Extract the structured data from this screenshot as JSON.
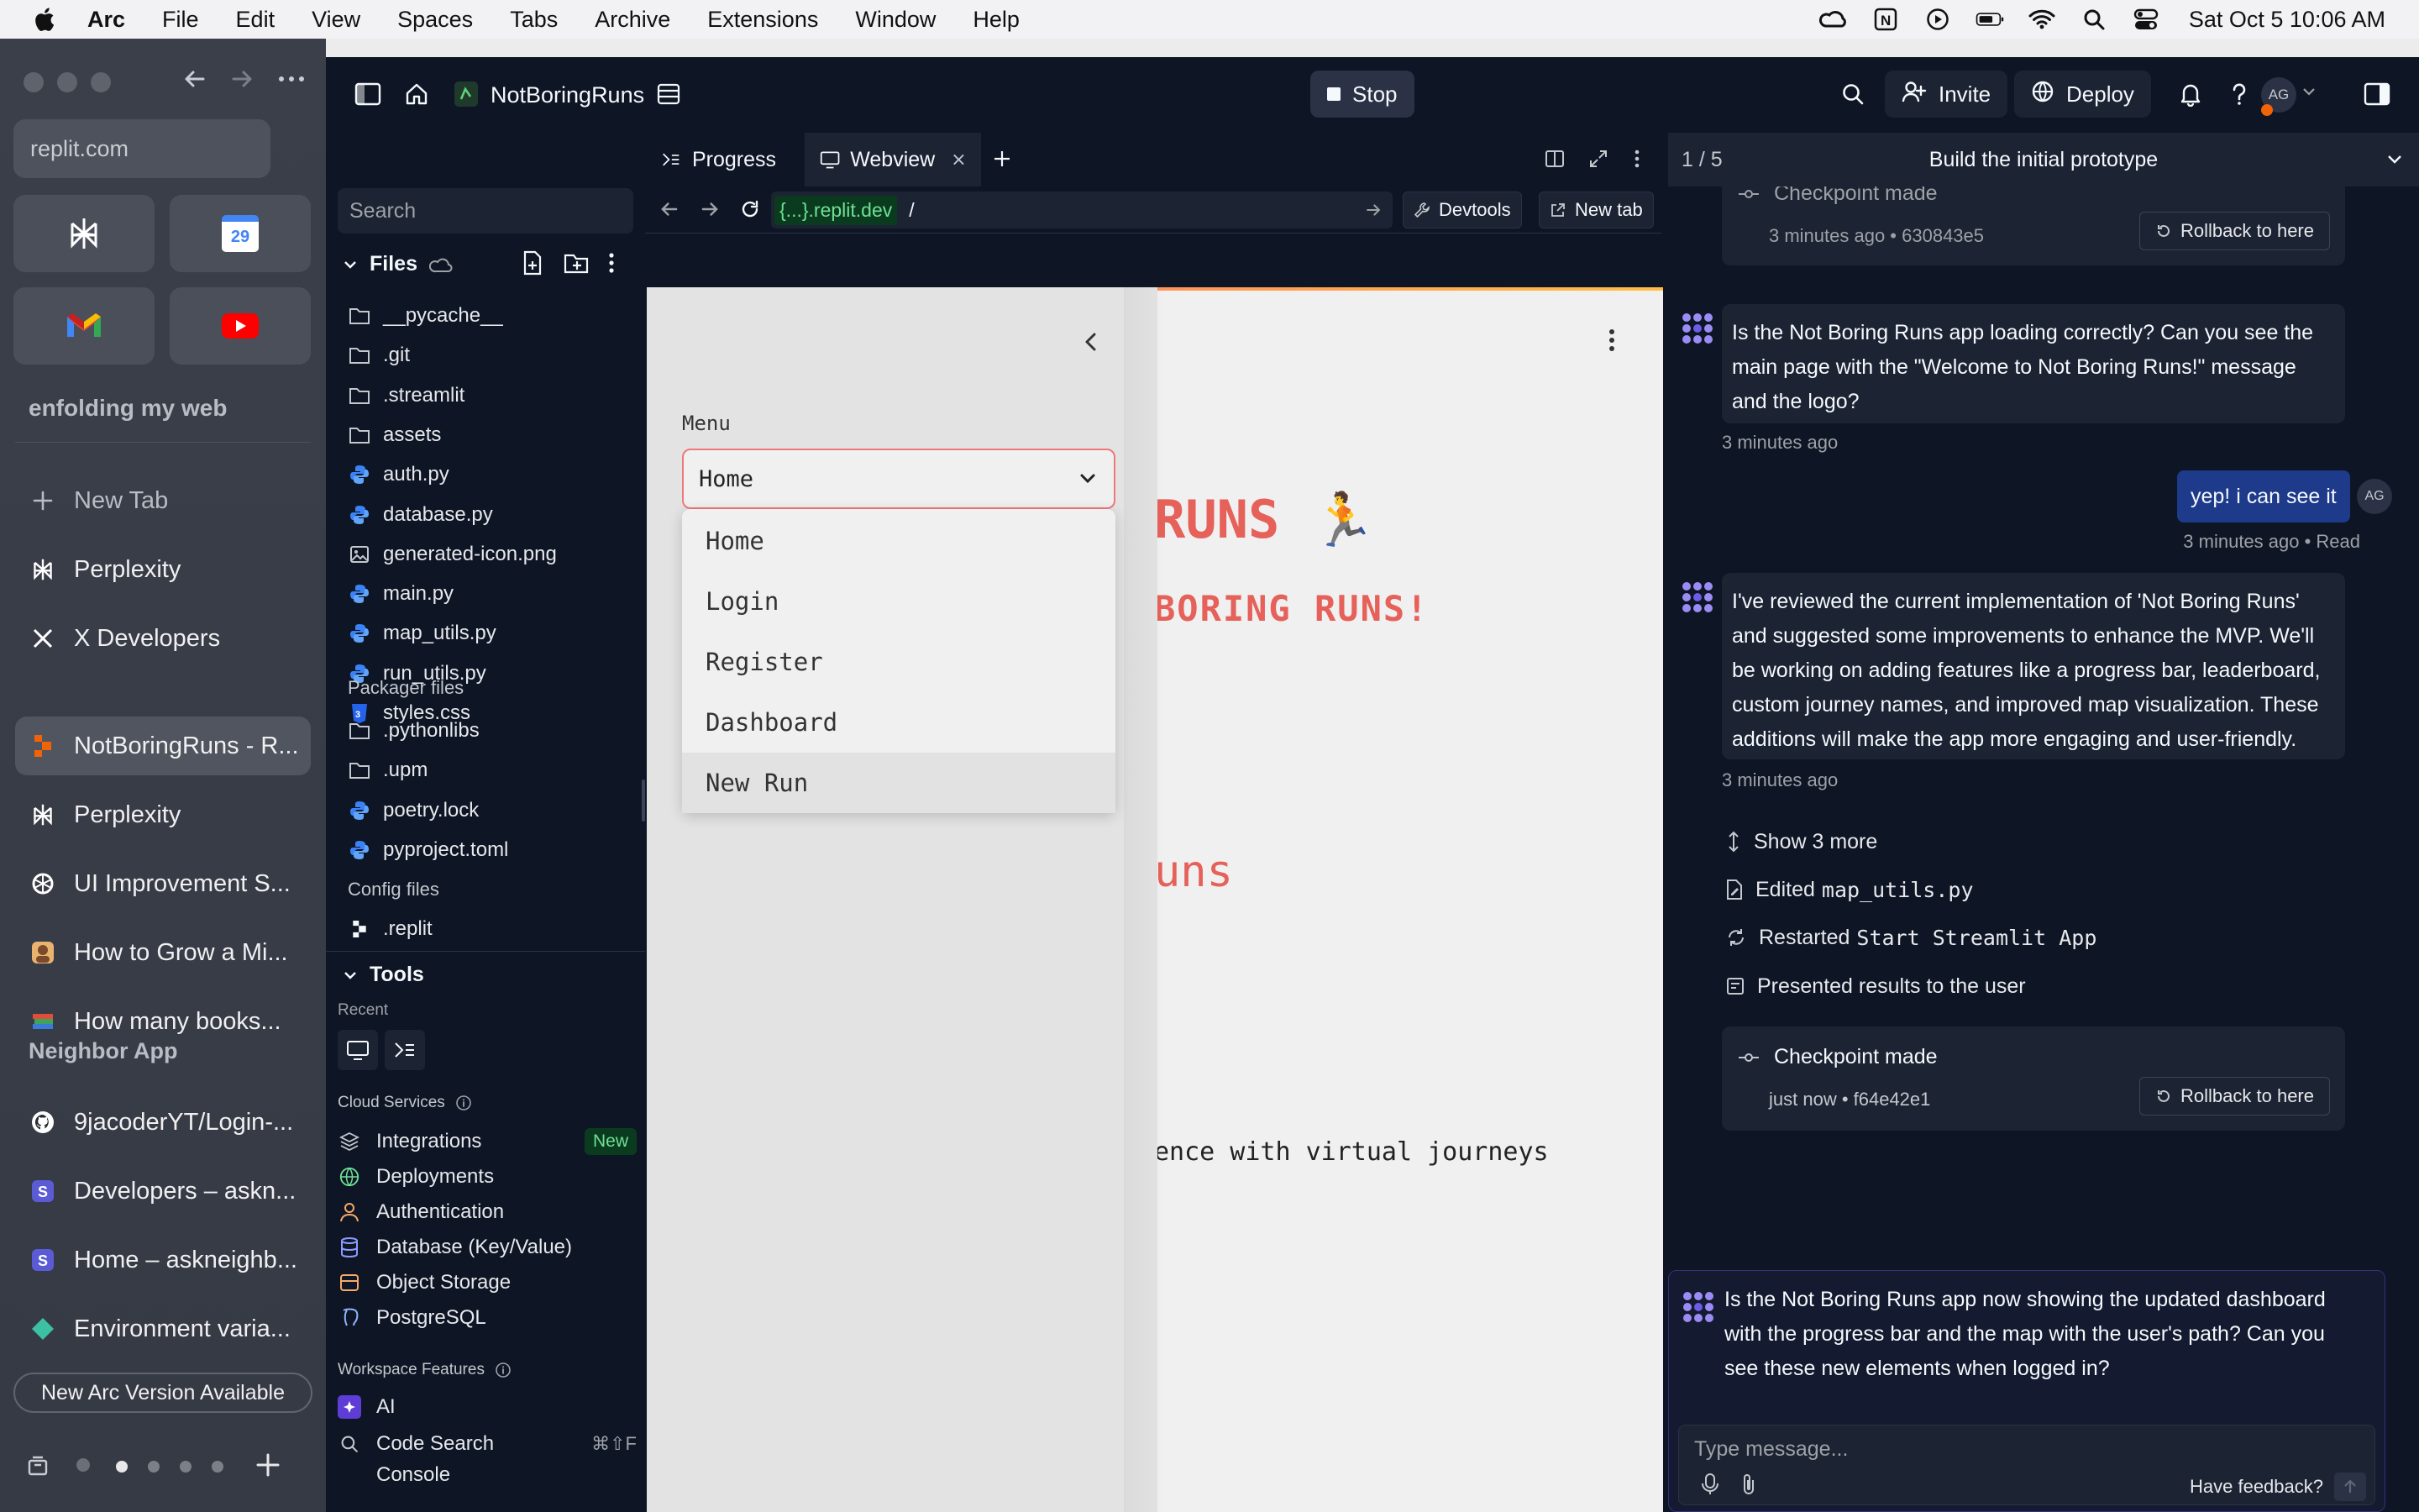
{
  "menubar": {
    "items": [
      "Arc",
      "File",
      "Edit",
      "View",
      "Spaces",
      "Tabs",
      "Archive",
      "Extensions",
      "Window",
      "Help"
    ],
    "clock": "Sat Oct 5  10:06 AM"
  },
  "arc": {
    "url": "replit.com",
    "space_name": "enfolding my web",
    "new_tab": "New Tab",
    "tabs": [
      "Perplexity",
      "X Developers",
      "NotBoringRuns - R...",
      "Perplexity",
      "UI Improvement S...",
      "How to Grow a Mi...",
      "How many books..."
    ],
    "section2": "Neighbor App",
    "section2_tabs": [
      "9jacoderYT/Login-...",
      "Developers – askn...",
      "Home – askneighb...",
      "Environment varia..."
    ],
    "update_banner": "New Arc Version Available",
    "calendar_day": "29"
  },
  "replit": {
    "project_name": "NotBoringRuns",
    "stop_label": "Stop",
    "invite_label": "Invite",
    "deploy_label": "Deploy",
    "avatar_initials": "AG",
    "search_placeholder": "Search",
    "files_title": "Files",
    "files": [
      {
        "name": "__pycache__",
        "icon": "folder-icon"
      },
      {
        "name": ".git",
        "icon": "folder-icon"
      },
      {
        "name": ".streamlit",
        "icon": "folder-icon"
      },
      {
        "name": "assets",
        "icon": "folder-icon"
      },
      {
        "name": "auth.py",
        "icon": "python-icon"
      },
      {
        "name": "database.py",
        "icon": "python-icon"
      },
      {
        "name": "generated-icon.png",
        "icon": "image-icon"
      },
      {
        "name": "main.py",
        "icon": "python-icon"
      },
      {
        "name": "map_utils.py",
        "icon": "python-icon"
      },
      {
        "name": "run_utils.py",
        "icon": "python-icon"
      },
      {
        "name": "styles.css",
        "icon": "css-icon"
      }
    ],
    "packager_title": "Packager files",
    "packager_files": [
      {
        "name": ".pythonlibs",
        "icon": "folder-icon"
      },
      {
        "name": ".upm",
        "icon": "folder-icon"
      },
      {
        "name": "poetry.lock",
        "icon": "python-icon"
      },
      {
        "name": "pyproject.toml",
        "icon": "python-icon"
      }
    ],
    "config_title": "Config files",
    "config_files": [
      ".replit"
    ],
    "tools_title": "Tools",
    "recent_label": "Recent",
    "cloud_label": "Cloud Services",
    "cloud_items": [
      "Integrations",
      "Deployments",
      "Authentication",
      "Database (Key/Value)",
      "Object Storage",
      "PostgreSQL"
    ],
    "new_badge": "New",
    "workspace_label": "Workspace Features",
    "workspace_items": [
      "AI",
      "Code Search",
      "Console"
    ],
    "code_search_shortcut": "⌘⇧F"
  },
  "webview": {
    "tab_progress": "Progress",
    "tab_webview": "Webview",
    "domain": "{...}.replit.dev",
    "path": "/",
    "devtools": "Devtools",
    "new_tab": "New tab"
  },
  "app": {
    "menu_label": "Menu",
    "selected": "Home",
    "options": [
      "Home",
      "Login",
      "Register",
      "Dashboard",
      "New Run"
    ],
    "title_fragment": "RUNS 🏃",
    "welcome_fragment": "BORING RUNS!",
    "runs_fragment": "uns",
    "tagline_fragment": "ence with virtual journeys"
  },
  "chat": {
    "task_counter": "1 / 5",
    "task_title": "Build the initial prototype",
    "checkpoint1": {
      "title": "Checkpoint made",
      "meta": "3 minutes ago • 630843e5",
      "rollback": "Rollback to here"
    },
    "msg1": "Is the Not Boring Runs app loading correctly? Can you see the main page with the \"Welcome to Not Boring Runs!\" message and the logo?",
    "msg1_time": "3 minutes ago",
    "user_msg": "yep! i can see it",
    "user_initials": "AG",
    "user_meta": "3 minutes ago • Read",
    "msg2": "I've reviewed the current implementation of 'Not Boring Runs' and suggested some improvements to enhance the MVP. We'll be working on adding features like a progress bar, leaderboard, custom journey names, and improved map visualization. These additions will make the app more engaging and user-friendly.",
    "msg2_time": "3 minutes ago",
    "show_more": "Show 3 more",
    "action_edited": "Edited",
    "action_edited_file": "map_utils.py",
    "action_restarted": "Restarted",
    "action_restarted_target": "Start Streamlit App",
    "action_presented": "Presented results to the user",
    "checkpoint2": {
      "title": "Checkpoint made",
      "meta": "just now • f64e42e1",
      "rollback": "Rollback to here"
    },
    "msg3": "Is the Not Boring Runs app now showing the updated dashboard with the progress bar and the map with the user's path? Can you see these new elements when logged in?",
    "input_placeholder": "Type message...",
    "feedback": "Have feedback?"
  },
  "colors": {
    "replit_bg": "#0e1525",
    "replit_surface": "#1c2333",
    "accent_red": "#e5615a",
    "select_border": "#f0787a",
    "arc_bg": "#3a3f4a"
  }
}
